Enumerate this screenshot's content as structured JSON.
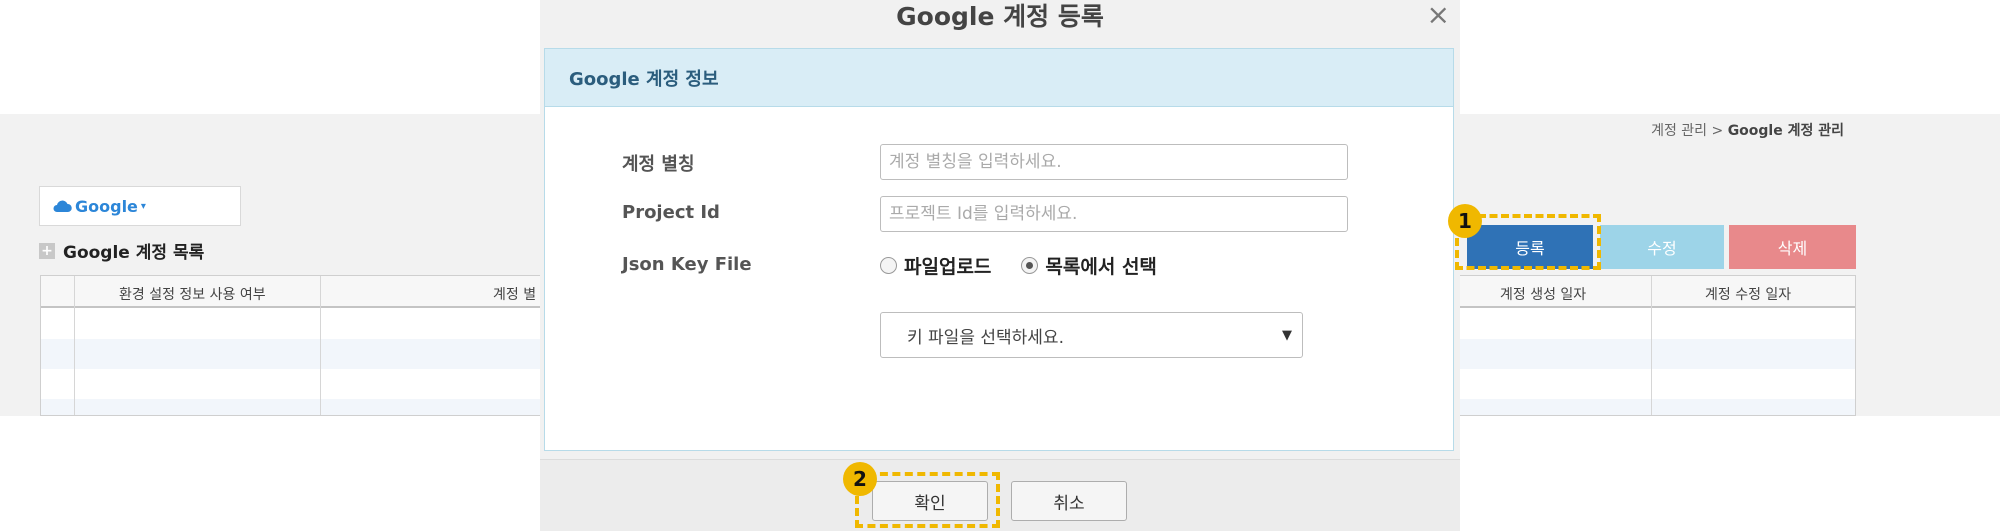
{
  "breadcrumb": {
    "prefix": "계정 관리 > ",
    "current": "Google 계정 관리"
  },
  "provider_select": {
    "value": "Google",
    "caret": "▾"
  },
  "list": {
    "title": "Google 계정 목록",
    "plus_icon": "+",
    "columns": [
      "환경 설정 정보 사용 여부",
      "계정 별",
      "계정 생성 일자",
      "계정 수정 일자"
    ]
  },
  "actions": {
    "register": "등록",
    "edit": "수정",
    "delete": "삭제"
  },
  "modal": {
    "title": "Google 계정 등록",
    "close": "×",
    "panel_title": "Google 계정 정보",
    "fields": {
      "alias_label": "계정 별칭",
      "alias_placeholder": "계정 별칭을 입력하세요.",
      "project_label": "Project Id",
      "project_placeholder": "프로젝트 Id를 입력하세요.",
      "json_label": "Json Key File",
      "radio_upload": "파일업로드",
      "radio_list": "목록에서 선택",
      "radio_selected": "목록에서 선택",
      "key_select_value": "키 파일을 선택하세요.",
      "key_select_arrow": "▼"
    },
    "confirm": "확인",
    "cancel": "취소"
  },
  "callouts": {
    "one": "1",
    "two": "2"
  },
  "colors": {
    "accent": "#2f72b6",
    "highlight": "#f0b800",
    "panel_head": "#d9edf6"
  }
}
